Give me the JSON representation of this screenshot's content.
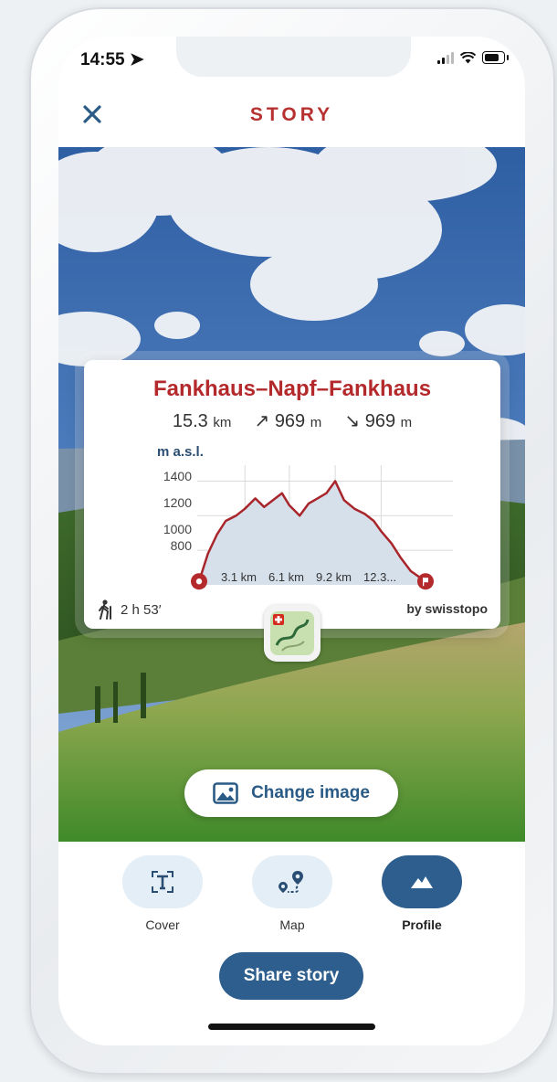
{
  "status_bar": {
    "time": "14:55"
  },
  "header": {
    "title": "STORY",
    "close_icon": "close-icon"
  },
  "story_card": {
    "title": "Fankhaus–Napf–Fankhaus",
    "distance": "15.3",
    "distance_unit": "km",
    "ascent": "969",
    "ascent_unit": "m",
    "descent": "969",
    "descent_unit": "m",
    "y_axis_label": "m a.s.l.",
    "y_ticks": [
      "1400",
      "1200",
      "1000",
      "800"
    ],
    "x_ticks": [
      "3.1 km",
      "6.1 km",
      "9.2 km",
      "12.3..."
    ],
    "duration": "2 h 53′",
    "byline": "by swisstopo",
    "colors": {
      "title": "#b3292c",
      "profile_line": "#a8262b",
      "profile_fill": "#d6e0eb"
    }
  },
  "chart_data": {
    "type": "area",
    "ylabel": "m a.s.l.",
    "ylim": [
      800,
      1450
    ],
    "xlim": [
      0,
      15.3
    ],
    "x": [
      0,
      0.6,
      1.2,
      1.8,
      2.5,
      3.1,
      3.8,
      4.4,
      5.0,
      5.6,
      6.1,
      6.8,
      7.4,
      8.0,
      8.6,
      9.2,
      9.8,
      10.5,
      11.2,
      11.8,
      12.3,
      13.0,
      13.6,
      14.3,
      15.3
    ],
    "y": [
      820,
      980,
      1090,
      1170,
      1200,
      1240,
      1300,
      1250,
      1290,
      1330,
      1260,
      1200,
      1270,
      1300,
      1330,
      1400,
      1290,
      1240,
      1210,
      1170,
      1110,
      1040,
      960,
      880,
      820
    ]
  },
  "actions": {
    "change_image": "Change image",
    "share_story": "Share story"
  },
  "tabs": [
    {
      "label": "Cover",
      "icon": "text-frame-icon",
      "active": false
    },
    {
      "label": "Map",
      "icon": "route-pin-icon",
      "active": false
    },
    {
      "label": "Profile",
      "icon": "mountain-icon",
      "active": true
    }
  ]
}
